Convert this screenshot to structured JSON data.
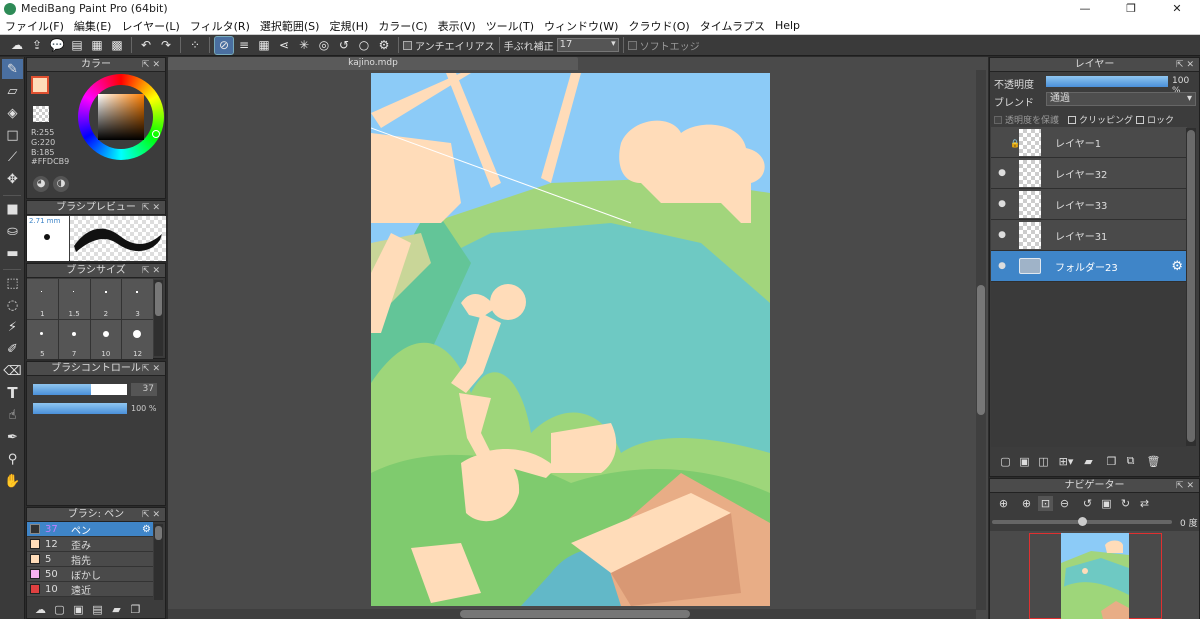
{
  "window": {
    "title": "MediBang Paint Pro (64bit)",
    "controls": [
      "—",
      "❐",
      "✕"
    ]
  },
  "menu": [
    "ファイル(F)",
    "編集(E)",
    "レイヤー(L)",
    "フィルタ(R)",
    "選択範囲(S)",
    "定規(H)",
    "カラー(C)",
    "表示(V)",
    "ツール(T)",
    "ウィンドウ(W)",
    "クラウド(O)",
    "タイムラプス",
    "Help"
  ],
  "toolbar": {
    "antialias_label": "アンチエイリアス",
    "stabilizer_label": "手ぶれ補正",
    "stabilizer_value": "17",
    "soft_edge_label": "ソフトエッジ"
  },
  "color_panel": {
    "title": "カラー",
    "r": "R:255",
    "g": "G:220",
    "b": "B:185",
    "hex": "#FFDCB9",
    "current": "#ffdcb9"
  },
  "brush_preview": {
    "title": "ブラシプレビュー",
    "size": "2.71 mm"
  },
  "brush_size": {
    "title": "ブラシサイズ",
    "sizes": [
      "1",
      "1.5",
      "2",
      "3",
      "5",
      "7",
      "10",
      "12"
    ]
  },
  "brush_control": {
    "title": "ブラシコントロール",
    "size_value": "37",
    "size_fraction": 0.62,
    "opacity_value": "100 %",
    "opacity_fraction": 1.0
  },
  "brush_list": {
    "title": "ブラシ: ペン",
    "items": [
      {
        "size": "37",
        "name": "ペン",
        "color": "#ffdcb9",
        "selected": true
      },
      {
        "size": "12",
        "name": "歪み",
        "color": "#ffdcb9"
      },
      {
        "size": "5",
        "name": "指先",
        "color": "#ffdcb9"
      },
      {
        "size": "50",
        "name": "ぼかし",
        "color": "#f6b0f0"
      },
      {
        "size": "10",
        "name": "遠近",
        "color": "#e04040"
      }
    ]
  },
  "document": {
    "tab": "kajino.mdp"
  },
  "layer_panel": {
    "title": "レイヤー",
    "opacity_label": "不透明度",
    "opacity_value": "100 %",
    "opacity_fraction": 1.0,
    "blend_label": "ブレンド",
    "blend_value": "通過",
    "protect_label": "透明度を保護",
    "clipping_label": "クリッピング",
    "lock_label": "ロック",
    "layers": [
      {
        "name": "レイヤー1",
        "locked": true,
        "visible": false
      },
      {
        "name": "レイヤー32",
        "visible": true
      },
      {
        "name": "レイヤー33",
        "visible": true
      },
      {
        "name": "レイヤー31",
        "visible": true
      },
      {
        "name": "フォルダー23",
        "visible": true,
        "folder": true,
        "selected": true
      }
    ]
  },
  "navigator": {
    "title": "ナビゲーター",
    "rotation": "0 度"
  }
}
